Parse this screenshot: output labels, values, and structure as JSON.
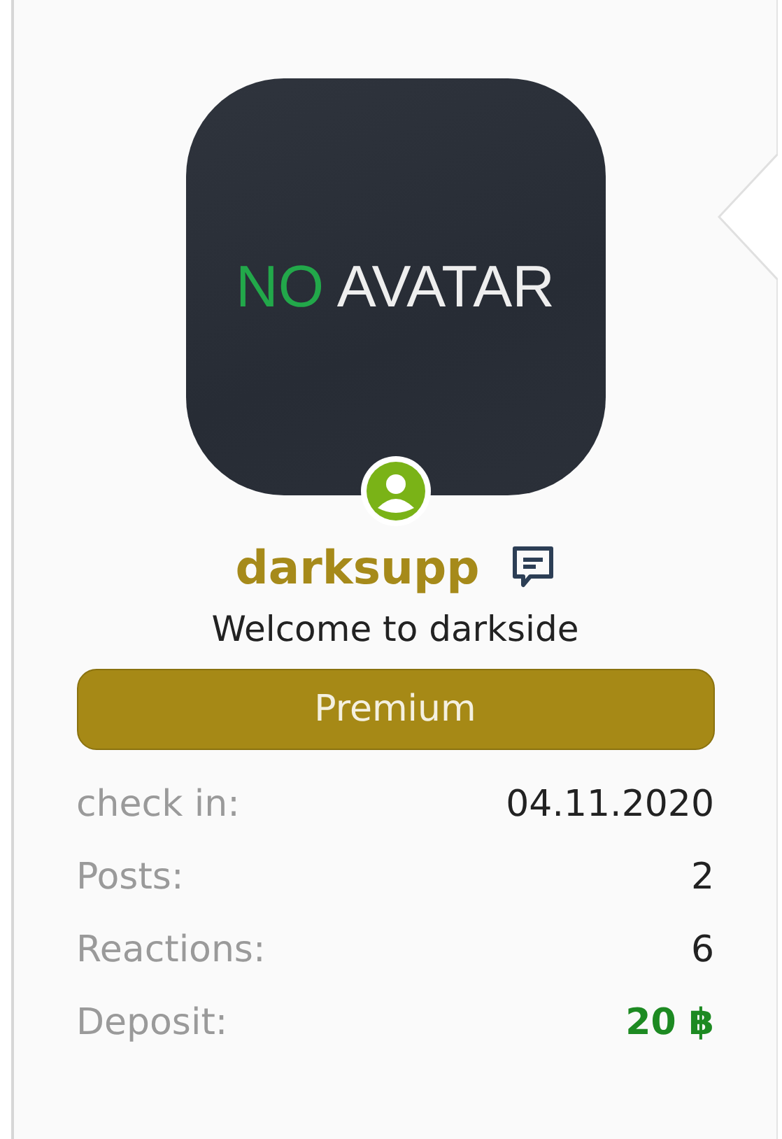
{
  "avatar": {
    "lead": "NO",
    "rest": "AVATAR",
    "online": true
  },
  "user": {
    "name": "darksupp",
    "title": "Welcome to darkside"
  },
  "banner": {
    "label": "Premium"
  },
  "stats": [
    {
      "label": "check in:",
      "value": "04.11.2020",
      "highlight": false
    },
    {
      "label": "Posts:",
      "value": "2",
      "highlight": false
    },
    {
      "label": "Reactions:",
      "value": "6",
      "highlight": false
    },
    {
      "label": "Deposit:",
      "value": "20 ฿",
      "highlight": true
    }
  ]
}
